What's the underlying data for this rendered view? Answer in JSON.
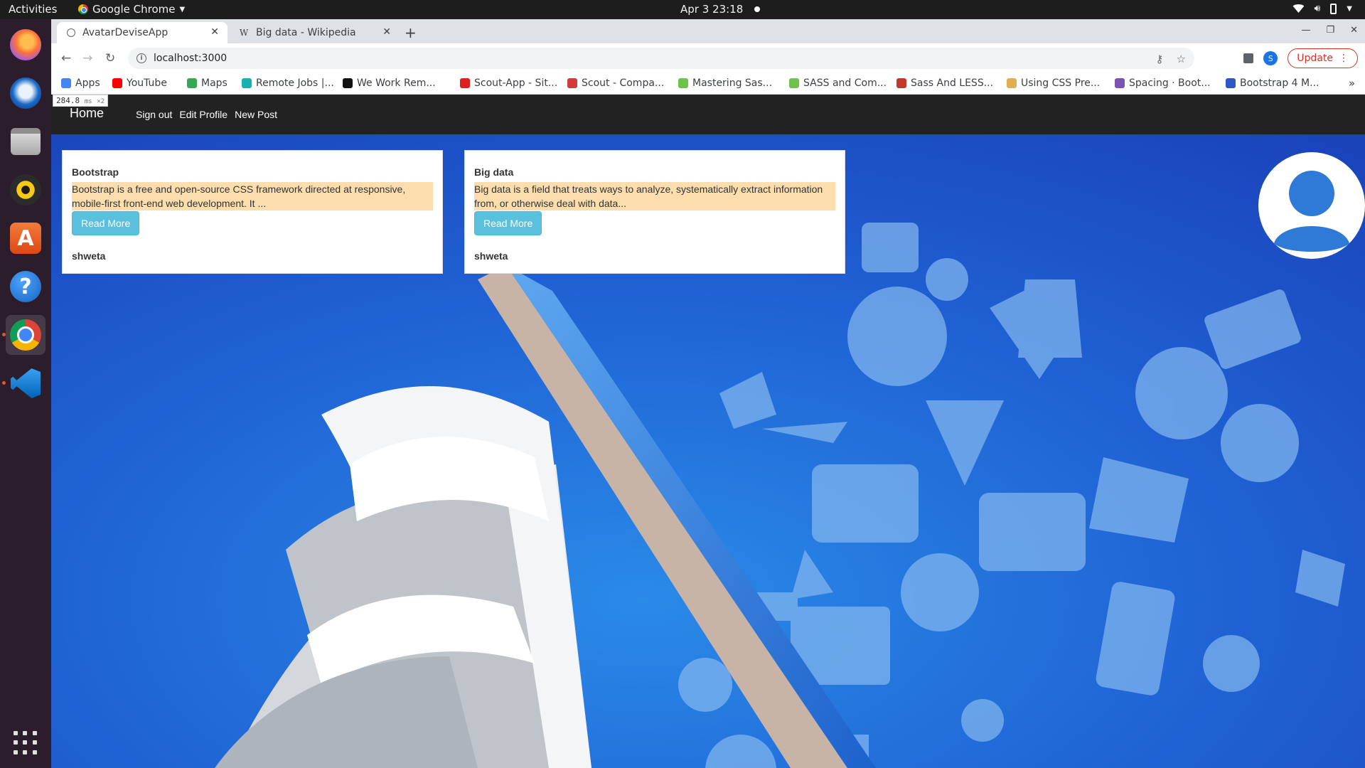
{
  "system": {
    "activities": "Activities",
    "app_name": "Google Chrome",
    "clock": "Apr 3  23:18"
  },
  "browser": {
    "tabs": [
      {
        "label": "AvatarDeviseApp",
        "active": true
      },
      {
        "label": "Big data - Wikipedia",
        "active": false
      }
    ],
    "url": "localhost:3000",
    "profile_initial": "S",
    "update_label": "Update",
    "bookmarks": [
      {
        "label": "Apps",
        "icon": "apps-grid-icon",
        "color": "#4285f4"
      },
      {
        "label": "YouTube",
        "icon": "youtube-icon",
        "color": "#ff0000"
      },
      {
        "label": "Maps",
        "icon": "maps-icon",
        "color": "#34a853"
      },
      {
        "label": "Remote Jobs |...",
        "icon": "remote-jobs-icon",
        "color": "#1ab0b0"
      },
      {
        "label": "We Work Rem...",
        "icon": "wwr-icon",
        "color": "#111111"
      },
      {
        "label": "Scout-App - Sit...",
        "icon": "scout-app-icon",
        "color": "#e02020"
      },
      {
        "label": "Scout - Compa...",
        "icon": "scout-company-icon",
        "color": "#d33a3a"
      },
      {
        "label": "Mastering Sas...",
        "icon": "leaf-icon",
        "color": "#6cc24a"
      },
      {
        "label": "SASS and Com...",
        "icon": "leaf-icon",
        "color": "#6cc24a"
      },
      {
        "label": "Sass And LESS...",
        "icon": "grid-red-icon",
        "color": "#c0392b"
      },
      {
        "label": "Using CSS Pre...",
        "icon": "trophy-icon",
        "color": "#e0b050"
      },
      {
        "label": "Spacing · Boot...",
        "icon": "bootstrap-icon",
        "color": "#7952b3"
      },
      {
        "label": "Bootstrap 4 M...",
        "icon": "bootstrap-m-icon",
        "color": "#2f56c5"
      }
    ]
  },
  "debug": {
    "timing": "284.8",
    "timing_unit": "ms",
    "timing_count": "×2"
  },
  "navbar": {
    "brand": "Home",
    "links": [
      "Sign out",
      "Edit Profile",
      "New Post"
    ]
  },
  "posts": [
    {
      "title": "Bootstrap",
      "summary": "Bootstrap is a free and open-source CSS framework directed at responsive, mobile-first front-end web development. It ...",
      "button": "Read More",
      "author": "shweta"
    },
    {
      "title": "Big data",
      "summary": "Big data is a field that treats ways to analyze, systematically extract information from, or otherwise deal with data...",
      "button": "Read More",
      "author": "shweta"
    }
  ],
  "colors": {
    "background_blue": "#1f62d4",
    "highlight": "#fcdeae",
    "button_info": "#5bc0de",
    "avatar_blue": "#2f7ad6",
    "navbar": "#222222"
  }
}
